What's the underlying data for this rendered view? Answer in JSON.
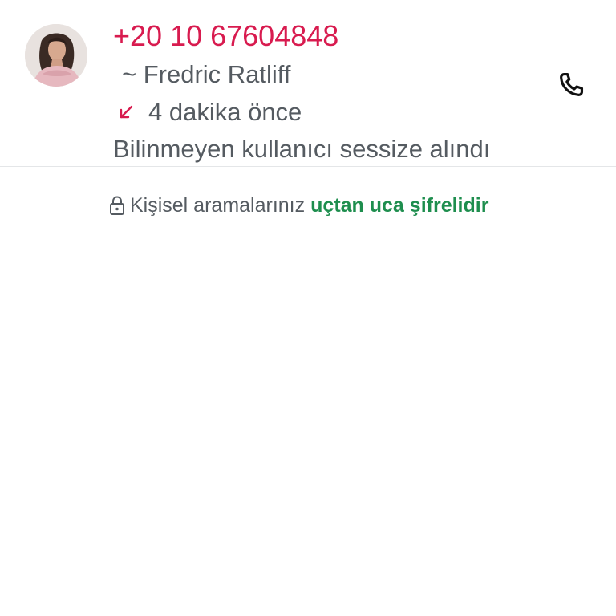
{
  "call": {
    "phone_number": "+20 10 67604848",
    "contact_name": "~ Fredric Ratliff",
    "time": "4 dakika önce",
    "status": "Bilinmeyen kullanıcı sessize alındı",
    "direction_icon": "missed-call-arrow-icon",
    "action_icon": "phone-icon"
  },
  "encryption": {
    "text": "Kişisel aramalarınız",
    "link": "uçtan uca şifrelidir",
    "icon": "lock-icon"
  },
  "colors": {
    "missed_red": "#d81b4f",
    "secondary_text": "#555b61",
    "link_green": "#1e8e4e"
  }
}
